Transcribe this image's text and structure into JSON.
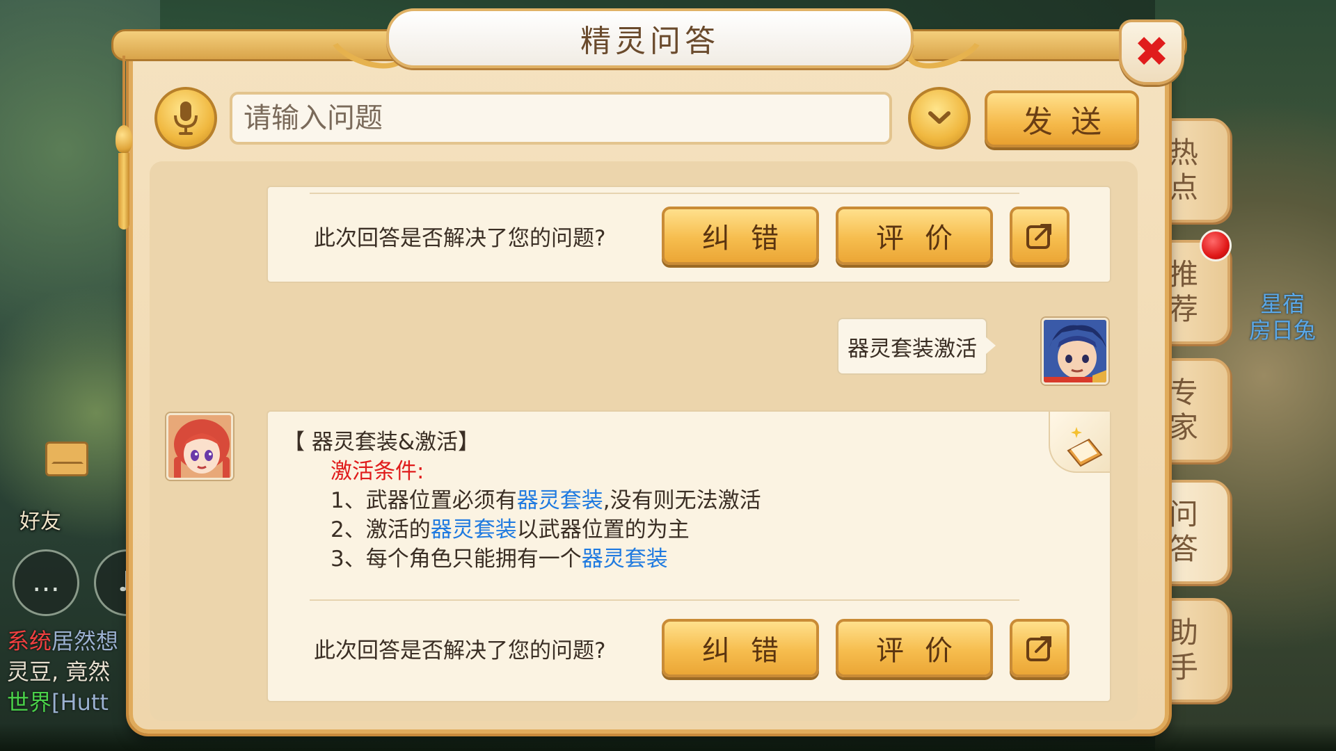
{
  "dialog": {
    "title": "精灵问答",
    "close_symbol": "✖",
    "input_placeholder": "请输入问题",
    "dropdown_symbol": "⌄",
    "send_label": "发送"
  },
  "side_tabs": [
    {
      "label": "热点"
    },
    {
      "label": "推荐"
    },
    {
      "label": "专家"
    },
    {
      "label": "问答"
    },
    {
      "label": "助手"
    }
  ],
  "feedback": {
    "question": "此次回答是否解决了您的问题?",
    "correct_label": "纠错",
    "rate_label": "评价"
  },
  "user_message": "器灵套装激活",
  "answer": {
    "title": "【 器灵套装&激活】",
    "subtitle": "激活条件:",
    "line1_pre": "1、武器位置必须有",
    "line1_hl": "器灵套装",
    "line1_post": ",没有则无法激活",
    "line2_pre": "2、激活的",
    "line2_hl": "器灵套装",
    "line2_post": "以武器位置的为主",
    "line3_pre": "3、每个角色只能拥有一个",
    "line3_hl": "器灵套装"
  },
  "background": {
    "friend_label": "好友",
    "star_label_1": "星宿",
    "star_label_2": "房日兔",
    "chat_sys_tag": "系统",
    "chat_sys_text": "居然想",
    "chat_line2": "灵豆, 竟然",
    "chat_world_tag": "世界",
    "chat_world_text": "[Hutt"
  },
  "colors": {
    "accent_gold": "#f6bd4e",
    "panel_bg": "#f5e2c0",
    "highlight_blue": "#1f7ae0",
    "condition_red": "#e01c1c",
    "notification_red": "#e01818"
  }
}
